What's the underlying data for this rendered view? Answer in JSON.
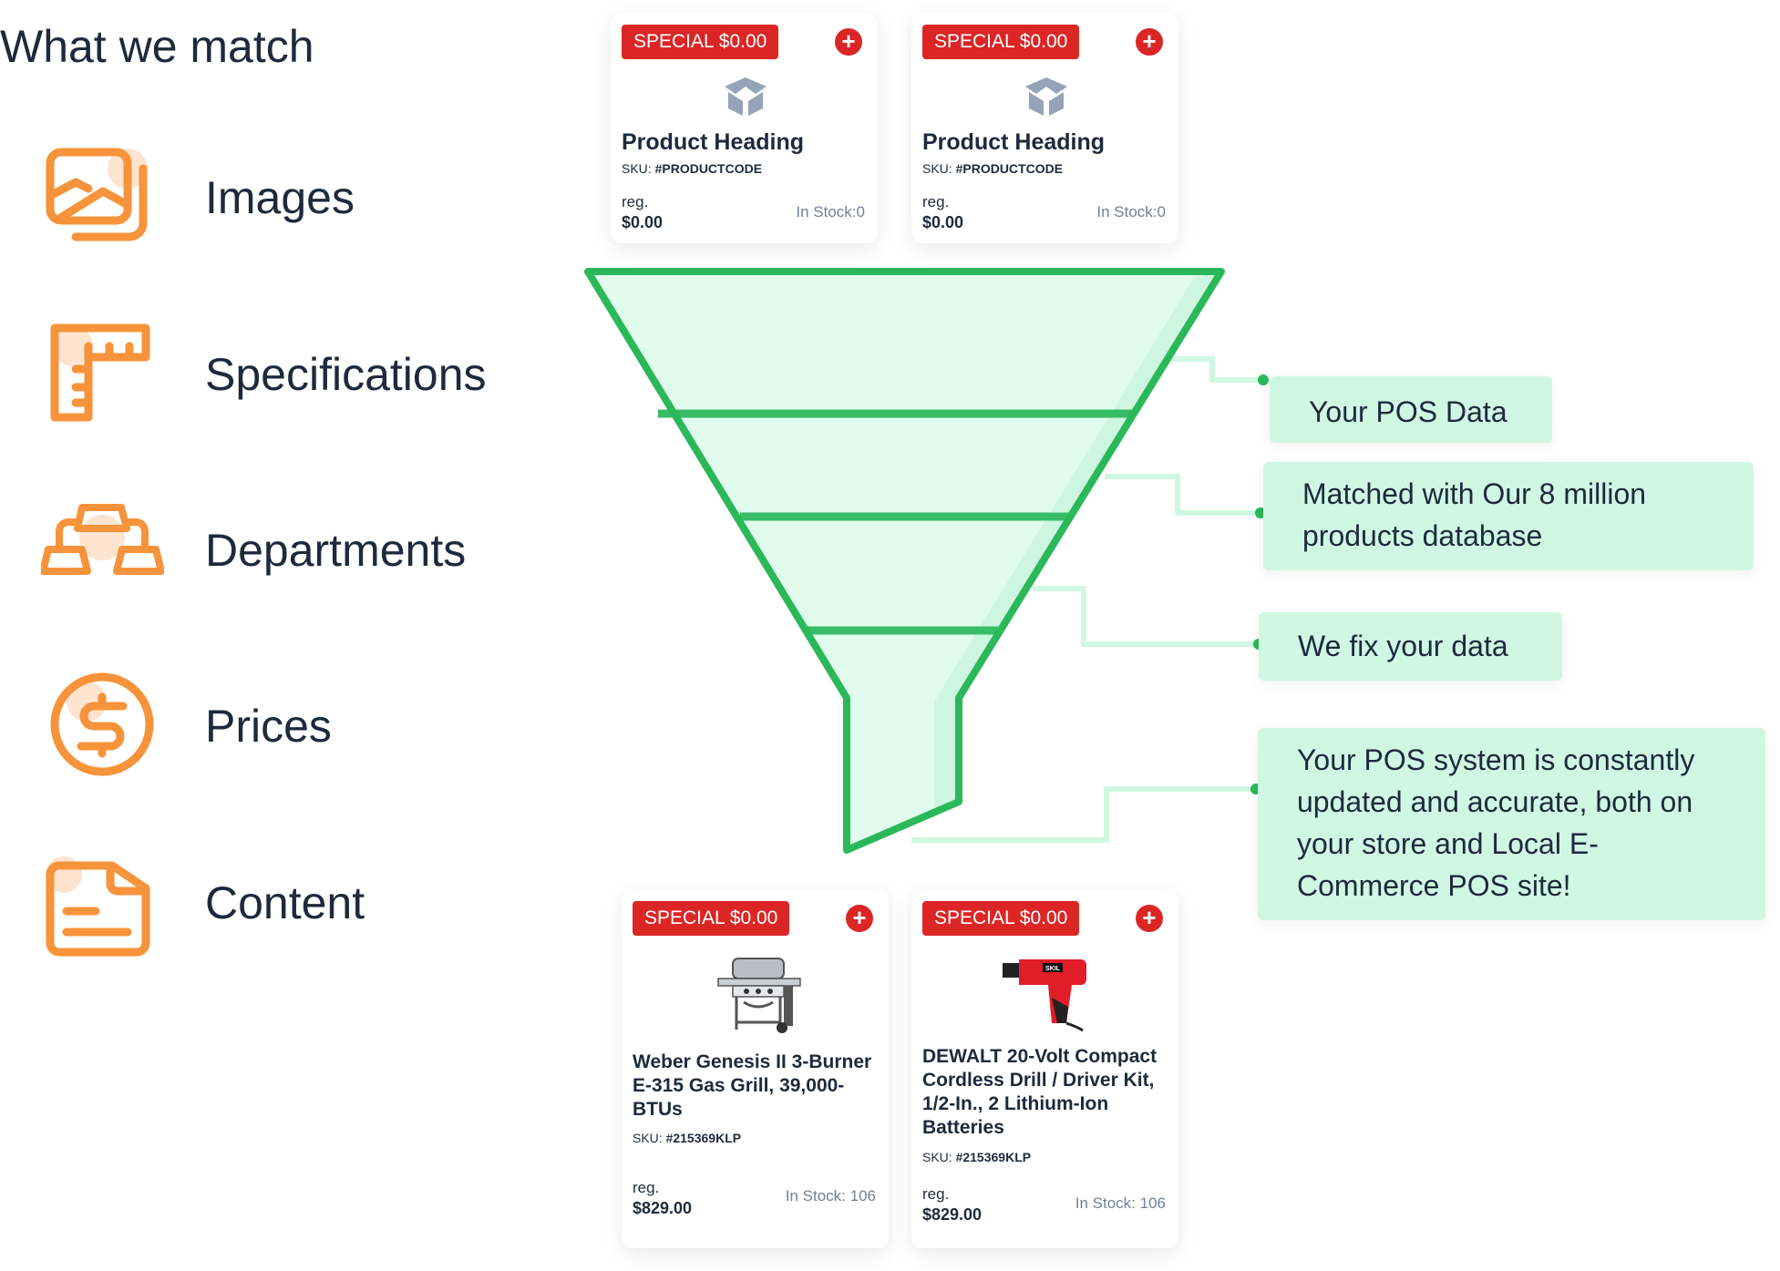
{
  "title": "What we match",
  "colors": {
    "accent": "#f7933a",
    "funnel": "#2bb85a",
    "callout_bg": "#cff7e3",
    "badge": "#dc2626"
  },
  "features": [
    {
      "label": "Images",
      "icon": "image-icon"
    },
    {
      "label": "Specifications",
      "icon": "ruler-icon"
    },
    {
      "label": "Departments",
      "icon": "hierarchy-icon"
    },
    {
      "label": "Prices",
      "icon": "dollar-coin-icon"
    },
    {
      "label": "Content",
      "icon": "document-icon"
    }
  ],
  "top_cards": [
    {
      "badge": "SPECIAL $0.00",
      "title": "Product Heading",
      "sku_label": "SKU:",
      "sku": "#PRODUCTCODE",
      "reg_label": "reg.",
      "price": "$0.00",
      "stock": "In Stock:0"
    },
    {
      "badge": "SPECIAL $0.00",
      "title": "Product Heading",
      "sku_label": "SKU:",
      "sku": "#PRODUCTCODE",
      "reg_label": "reg.",
      "price": "$0.00",
      "stock": "In Stock:0"
    }
  ],
  "bottom_cards": [
    {
      "badge": "SPECIAL $0.00",
      "title": "Weber Genesis II 3-Burner E-315 Gas Grill, 39,000-BTUs",
      "sku_label": "SKU:",
      "sku": "#215369KLP",
      "reg_label": "reg.",
      "price": "$829.00",
      "stock": "In Stock: 106"
    },
    {
      "badge": "SPECIAL $0.00",
      "title": "DEWALT 20-Volt Compact Cordless Drill / Driver Kit, 1/2-In., 2 Lithium-Ion Batteries",
      "sku_label": "SKU:",
      "sku": "#215369KLP",
      "reg_label": "reg.",
      "price": "$829.00",
      "stock": "In Stock: 106",
      "brand": "SKIL"
    }
  ],
  "callouts": [
    "Your POS Data",
    "Matched with Our 8 million products database",
    "We fix your data",
    "Your POS system is constantly updated and accurate, both on your store and Local E-Commerce POS site!"
  ]
}
